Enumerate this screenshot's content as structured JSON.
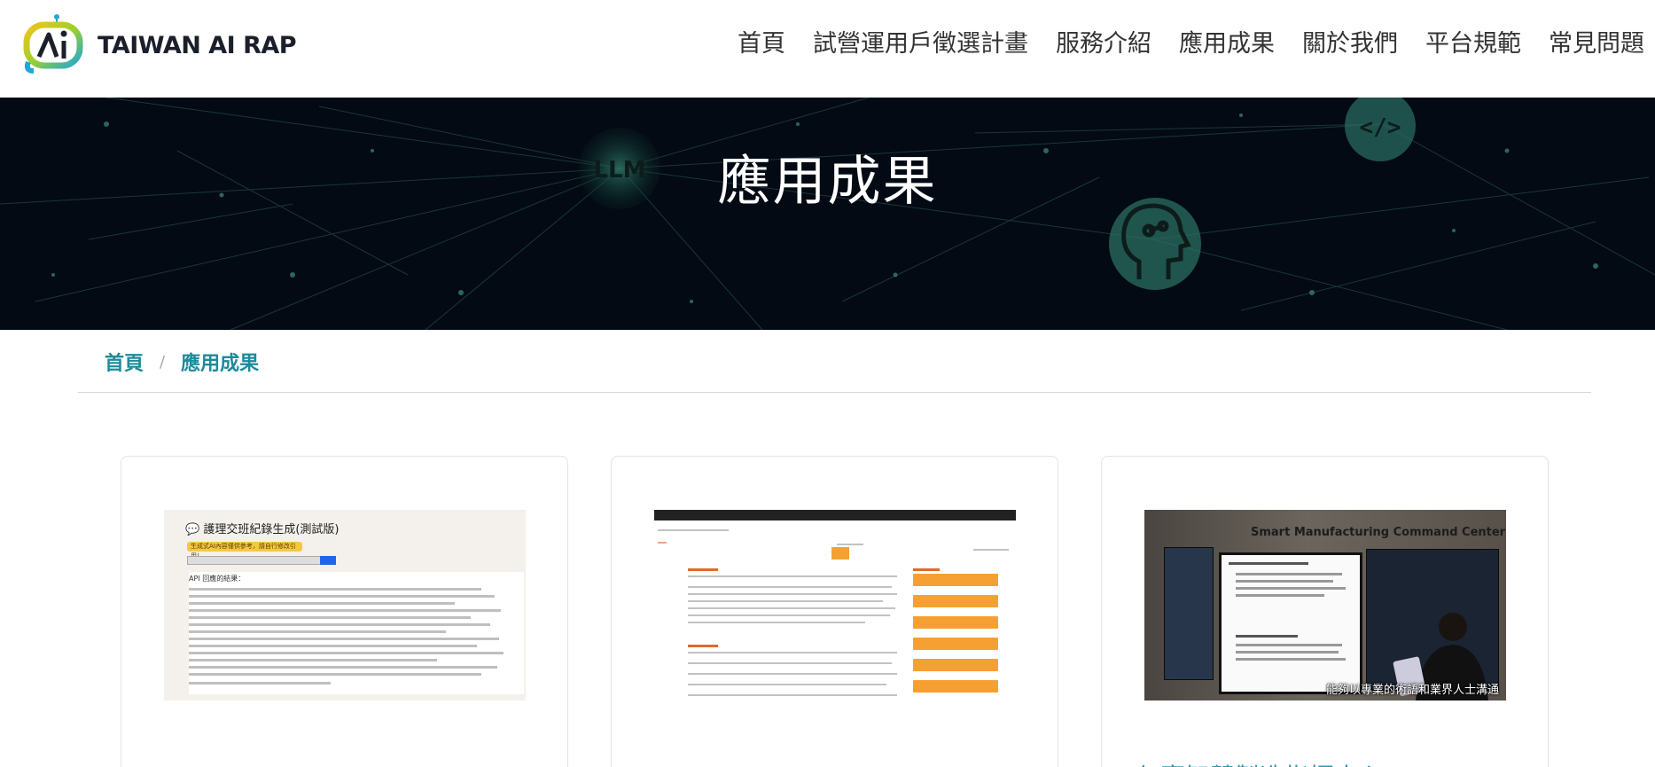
{
  "header": {
    "logo_text": "TAIWAN AI RAP",
    "nav": [
      "首頁",
      "試營運用戶徵選計畫",
      "服務介紹",
      "應用成果",
      "關於我們",
      "平台規範",
      "常見問題"
    ]
  },
  "hero": {
    "title": "應用成果",
    "badges": [
      "LLM",
      "</>"
    ]
  },
  "breadcrumb": {
    "home": "首頁",
    "separator": "/",
    "current": "應用成果"
  },
  "cards": [
    {
      "image_title": "護理交班紀錄生成(測試版)",
      "image_tag": "生成式AI內容僅供參考，請自行修改引用！",
      "image_section": "API 回應的結果：",
      "title": ""
    },
    {
      "image_title": "",
      "title": ""
    },
    {
      "image_title": "Smart Manufacturing Command Center",
      "image_caption": "能夠以專業的術語和業界人士溝通",
      "title": "仁寶智慧製造指揮中心"
    }
  ],
  "colors": {
    "accent": "#1e8a9a",
    "hero_bg": "#030a14",
    "link": "#2a9ab0"
  }
}
